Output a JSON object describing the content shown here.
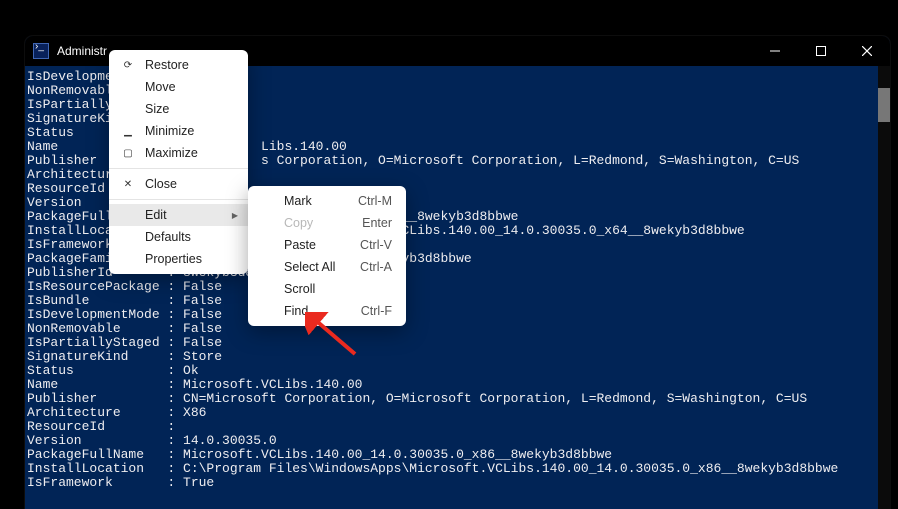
{
  "window": {
    "title": "Administr",
    "colors": {
      "terminal_bg": "#012456",
      "terminal_fg": "#eeedf0",
      "arrow": "#ea2a1f"
    }
  },
  "context_menu_main": {
    "items": [
      {
        "label": "Restore",
        "glyph": "⟳"
      },
      {
        "label": "Move",
        "glyph": ""
      },
      {
        "label": "Size",
        "glyph": ""
      },
      {
        "label": "Minimize",
        "glyph": "▁"
      },
      {
        "label": "Maximize",
        "glyph": "▢"
      },
      {
        "sep": true
      },
      {
        "label": "Close",
        "glyph": "✕"
      },
      {
        "sep": true
      },
      {
        "label": "Edit",
        "submenu": true,
        "highlight": true
      },
      {
        "label": "Defaults"
      },
      {
        "label": "Properties"
      }
    ]
  },
  "context_menu_edit": {
    "items": [
      {
        "label": "Mark",
        "shortcut": "Ctrl-M"
      },
      {
        "label": "Copy",
        "shortcut": "Enter",
        "disabled": true
      },
      {
        "label": "Paste",
        "shortcut": "Ctrl-V"
      },
      {
        "label": "Select All",
        "shortcut": "Ctrl-A"
      },
      {
        "label": "Scroll"
      },
      {
        "label": "Find...",
        "shortcut": "Ctrl-F"
      }
    ]
  },
  "terminal_lines": [
    "IsDevelopmen",
    "NonRemovable",
    "IsPartiallyS",
    "SignatureKin",
    "Status",
    "",
    "Name                          Libs.140.00",
    "Publisher                     s Corporation, O=Microsoft Corporation, L=Redmond, S=Washington, C=US",
    "Architecture",
    "ResourceId",
    "Version",
    "PackageFullN                               0_x64__8wekyb3d8bbwe",
    "InstallLocat                               oft.VCLibs.140.00_14.0.30035.0_x64__8wekyb3d8bbwe",
    "IsFramework       : True",
    "PackageFamilyName : Microsoft.VCLibs.140.00_8wekyb3d8bbwe",
    "PublisherId       : 8wekyb3d8bb",
    "IsResourcePackage : False",
    "IsBundle          : False",
    "IsDevelopmentMode : False",
    "NonRemovable      : False",
    "IsPartiallyStaged : False",
    "SignatureKind     : Store",
    "Status            : Ok",
    "",
    "Name              : Microsoft.VCLibs.140.00",
    "Publisher         : CN=Microsoft Corporation, O=Microsoft Corporation, L=Redmond, S=Washington, C=US",
    "Architecture      : X86",
    "ResourceId        :",
    "Version           : 14.0.30035.0",
    "PackageFullName   : Microsoft.VCLibs.140.00_14.0.30035.0_x86__8wekyb3d8bbwe",
    "InstallLocation   : C:\\Program Files\\WindowsApps\\Microsoft.VCLibs.140.00_14.0.30035.0_x86__8wekyb3d8bbwe",
    "IsFramework       : True"
  ]
}
